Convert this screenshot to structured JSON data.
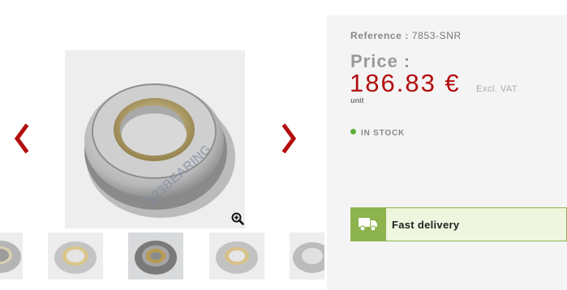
{
  "gallery": {
    "main_image_alt": "Thrust bearing",
    "watermark": "123BEARING",
    "prev_icon": "chevron-left-icon",
    "next_icon": "chevron-right-icon",
    "zoom_icon": "zoom-in-icon",
    "colors": {
      "arrow": "#b30e0e"
    }
  },
  "product": {
    "reference_label": "Reference :",
    "reference_value": "7853-SNR",
    "price_label": "Price :",
    "price_value": "186.83 €",
    "price_note": "Excl. VAT",
    "unit_label": "unit",
    "stock_status": "IN STOCK",
    "delivery_label": "Fast delivery",
    "delivery_icon": "truck-icon",
    "colors": {
      "price": "#b30e0e",
      "stock_dot": "#5fae3a",
      "delivery": "#8db34e"
    }
  }
}
